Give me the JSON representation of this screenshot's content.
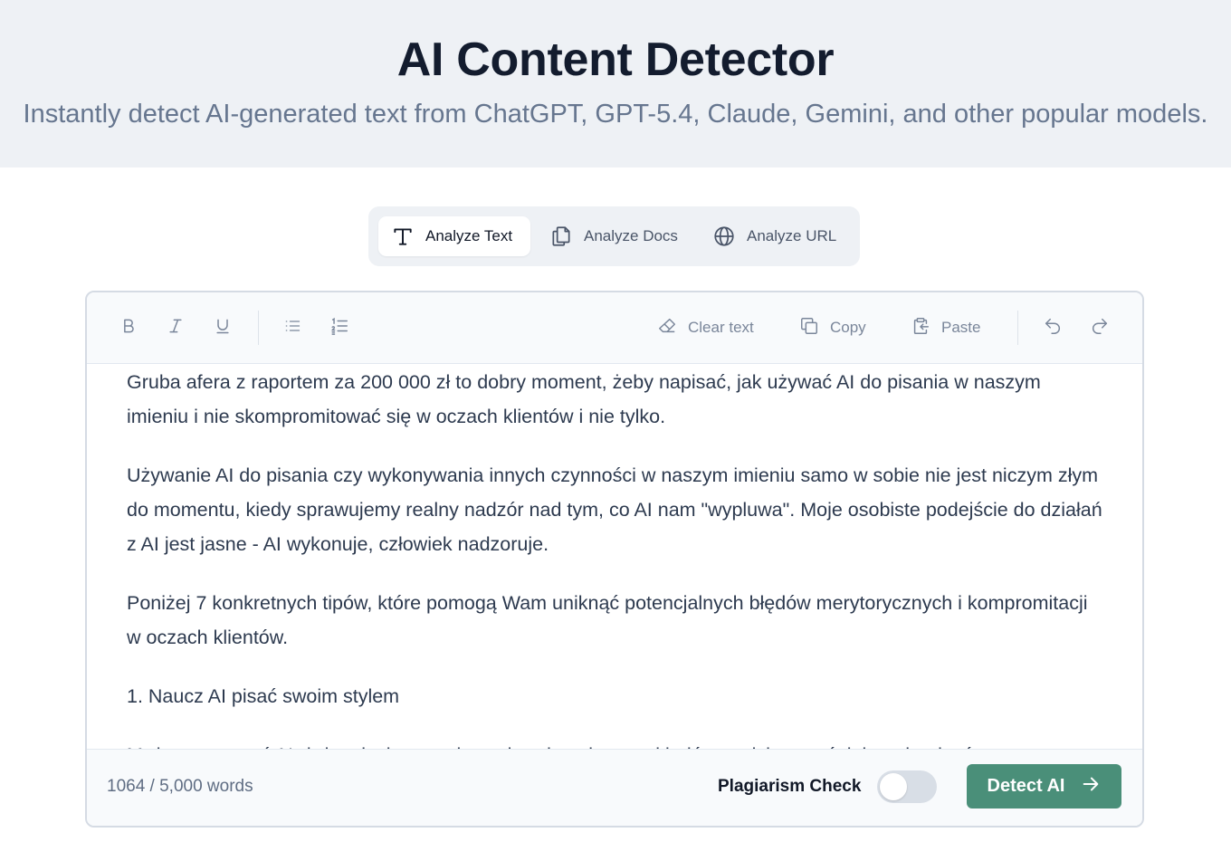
{
  "header": {
    "title": "AI Content Detector",
    "subtitle": "Instantly detect AI-generated text from ChatGPT, GPT-5.4, Claude, Gemini, and other popular models."
  },
  "tabs": [
    {
      "label": "Analyze Text",
      "icon": "text-icon",
      "active": true
    },
    {
      "label": "Analyze Docs",
      "icon": "documents-icon",
      "active": false
    },
    {
      "label": "Analyze URL",
      "icon": "globe-icon",
      "active": false
    }
  ],
  "toolbar": {
    "format_icons": [
      "bold-icon",
      "italic-icon",
      "underline-icon",
      "bullet-list-icon",
      "numbered-list-icon"
    ],
    "clear_label": "Clear text",
    "copy_label": "Copy",
    "paste_label": "Paste",
    "history_icons": [
      "undo-icon",
      "redo-icon"
    ]
  },
  "content": {
    "paragraphs": [
      "Gruba afera z raportem za 200 000 zł to dobry moment, żeby napisać, jak używać AI do pisania w naszym imieniu i nie skompromitować się w oczach klientów i nie tylko.",
      "Używanie AI do pisania czy wykonywania innych czynności w naszym imieniu samo w sobie nie jest niczym złym do momentu, kiedy sprawujemy realny nadzór nad tym, co AI nam \"wypluwa\". Moje osobiste podejście do działań z AI jest jasne - AI wykonuje, człowiek nadzoruje.",
      "Poniżej 7 konkretnych tipów, które pomogą Wam uniknąć potencjalnych błędów merytorycznych i kompromitacji w oczach klientów.",
      "1. Naucz AI pisać swoim stylem",
      "Możesz nauczyć AI, żeby pisało w twoim stylu, używając przykładów twoich wcześniejszych tekstów."
    ]
  },
  "footer": {
    "word_count": "1064 / 5,000 words",
    "plagiarism_label": "Plagiarism Check",
    "plagiarism_enabled": false,
    "detect_label": "Detect AI"
  },
  "colors": {
    "accent": "#4a8f79",
    "hero_bg": "#eef1f5",
    "title": "#131c2e",
    "muted": "#66768f"
  }
}
